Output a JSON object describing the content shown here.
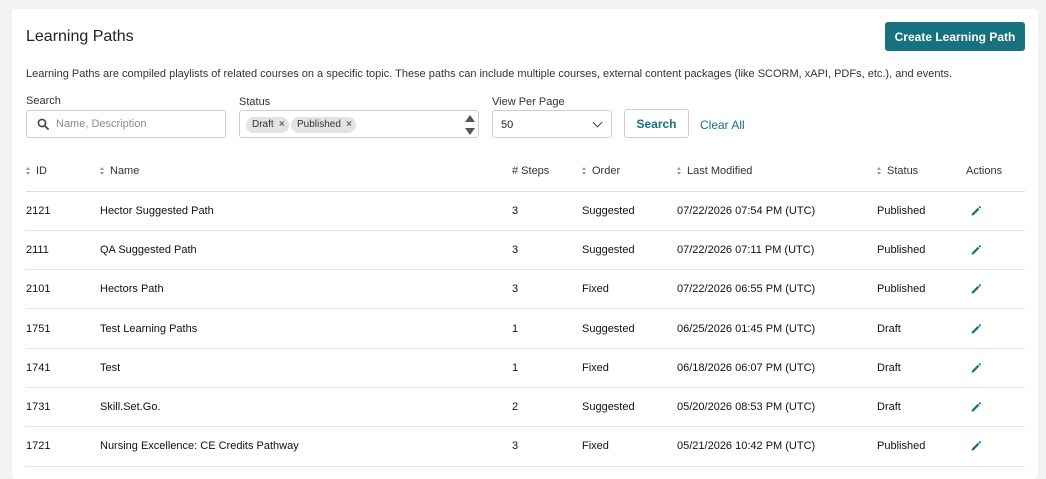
{
  "header": {
    "title": "Learning Paths",
    "create_label": "Create Learning Path",
    "description": "Learning Paths are compiled playlists of related courses on a specific topic. These paths can include multiple courses, external content packages (like SCORM, xAPI, PDFs, etc.), and events."
  },
  "filters": {
    "search_label": "Search",
    "search_placeholder": "Name, Description",
    "status_label": "Status",
    "status_chips": [
      "Draft",
      "Published"
    ],
    "view_label": "View Per Page",
    "view_value": "50",
    "search_button": "Search",
    "clear_all": "Clear All"
  },
  "colors": {
    "accent": "#17717f"
  },
  "table": {
    "headers": {
      "id": "ID",
      "name": "Name",
      "steps": "# Steps",
      "order": "Order",
      "modified": "Last Modified",
      "status": "Status",
      "actions": "Actions"
    },
    "rows": [
      {
        "id": "2121",
        "name": "Hector Suggested Path",
        "steps": "3",
        "order": "Suggested",
        "modified": "07/22/2026 07:54 PM (UTC)",
        "status": "Published"
      },
      {
        "id": "2111",
        "name": "QA Suggested Path",
        "steps": "3",
        "order": "Suggested",
        "modified": "07/22/2026 07:11 PM (UTC)",
        "status": "Published"
      },
      {
        "id": "2101",
        "name": "Hectors Path",
        "steps": "3",
        "order": "Fixed",
        "modified": "07/22/2026 06:55 PM (UTC)",
        "status": "Published"
      },
      {
        "id": "1751",
        "name": "Test Learning Paths",
        "steps": "1",
        "order": "Suggested",
        "modified": "06/25/2026 01:45 PM (UTC)",
        "status": "Draft"
      },
      {
        "id": "1741",
        "name": "Test",
        "steps": "1",
        "order": "Fixed",
        "modified": "06/18/2026 06:07 PM (UTC)",
        "status": "Draft"
      },
      {
        "id": "1731",
        "name": "Skill.Set.Go.",
        "steps": "2",
        "order": "Suggested",
        "modified": "05/20/2026 08:53 PM (UTC)",
        "status": "Draft"
      },
      {
        "id": "1721",
        "name": "Nursing Excellence: CE Credits Pathway",
        "steps": "3",
        "order": "Fixed",
        "modified": "05/21/2026 10:42 PM (UTC)",
        "status": "Published"
      }
    ]
  }
}
